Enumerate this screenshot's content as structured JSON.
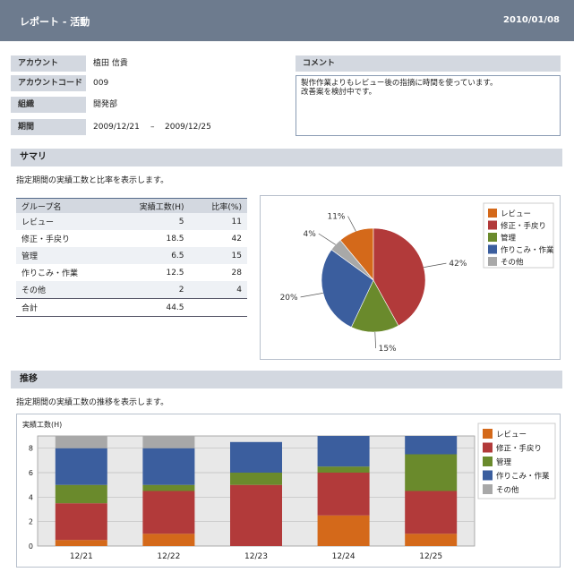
{
  "header": {
    "title": "レポート - 活動",
    "date": "2010/01/08"
  },
  "info": {
    "account_label": "アカウント",
    "account_value": "植田 信貴",
    "code_label": "アカウントコード",
    "code_value": "009",
    "org_label": "組織",
    "org_value": "開発部",
    "period_label": "期間",
    "period_start": "2009/12/21",
    "period_sep": "–",
    "period_end": "2009/12/25"
  },
  "comment": {
    "label": "コメント",
    "text": "製作作業よりもレビュー後の指摘に時間を使っています。\n改善案を検討中です。"
  },
  "summary": {
    "title": "サマリ",
    "desc": "指定期間の実績工数と比率を表示します。",
    "headers": [
      "グループ名",
      "実績工数(H)",
      "比率(%)"
    ],
    "rows": [
      [
        "レビュー",
        "5",
        "11"
      ],
      [
        "修正・手戻り",
        "18.5",
        "42"
      ],
      [
        "管理",
        "6.5",
        "15"
      ],
      [
        "作りこみ・作業",
        "12.5",
        "28"
      ],
      [
        "その他",
        "2",
        "4"
      ]
    ],
    "total_label": "合計",
    "total_value": "44.5"
  },
  "trend": {
    "title": "推移",
    "desc": "指定期間の実績工数の推移を表示します。"
  },
  "colors": {
    "review": "#d4691a",
    "rework": "#b23a3a",
    "mgmt": "#6a8a2c",
    "make": "#3b5e9e",
    "other": "#a8a8a8"
  },
  "chart_data": [
    {
      "type": "pie",
      "categories": [
        "レビュー",
        "修正・手戻り",
        "管理",
        "作りこみ・作業",
        "その他"
      ],
      "values": [
        11,
        42,
        15,
        28,
        4
      ],
      "labels": [
        "11%",
        "42%",
        "15%",
        "20%",
        "4%"
      ],
      "legend": "right"
    },
    {
      "type": "bar",
      "stacked": true,
      "ylabel": "実績工数(H)",
      "categories": [
        "12/21",
        "12/22",
        "12/23",
        "12/24",
        "12/25"
      ],
      "series": [
        {
          "name": "レビュー",
          "values": [
            0.5,
            1,
            0,
            2.5,
            1
          ]
        },
        {
          "name": "修正・手戻り",
          "values": [
            3,
            3.5,
            5,
            3.5,
            3.5
          ]
        },
        {
          "name": "管理",
          "values": [
            1.5,
            0.5,
            1,
            0.5,
            3
          ]
        },
        {
          "name": "作りこみ・作業",
          "values": [
            3,
            3,
            2.5,
            2.5,
            1.5
          ]
        },
        {
          "name": "その他",
          "values": [
            1,
            1,
            0,
            0,
            0
          ]
        }
      ],
      "ylim": [
        0,
        9
      ],
      "yticks": [
        0,
        2,
        4,
        6,
        8
      ],
      "grid": true,
      "legend": "right"
    }
  ]
}
